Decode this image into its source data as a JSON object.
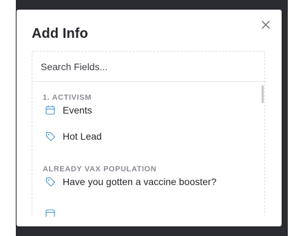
{
  "modal": {
    "title": "Add Info",
    "close_icon": "close-icon"
  },
  "search": {
    "placeholder": "Search Fields...",
    "value": ""
  },
  "groups": [
    {
      "header": "1. ACTIVISM",
      "items": [
        {
          "label": "Events",
          "icon": "calendar-icon"
        },
        {
          "label": "Hot Lead",
          "icon": "tag-icon"
        }
      ]
    },
    {
      "header": "ALREADY VAX POPULATION",
      "items": [
        {
          "label": "Have you gotten a vaccine booster?",
          "icon": "tag-icon"
        },
        {
          "label": "",
          "icon": "calendar-icon"
        }
      ]
    }
  ],
  "colors": {
    "backdrop": "#2b2c31",
    "icon": "#4f93c7",
    "header_text": "#8a8d95"
  }
}
